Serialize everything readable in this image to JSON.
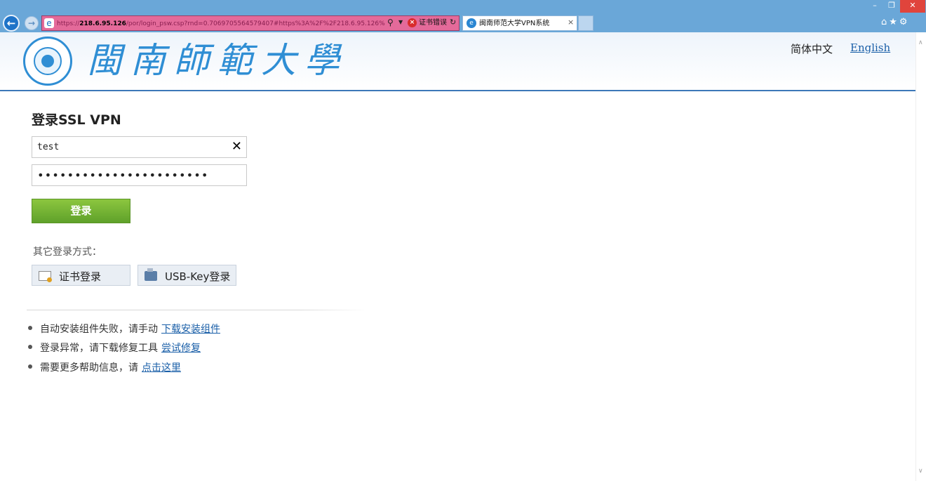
{
  "browser": {
    "url_prefix": "https://",
    "url_host": "218.6.95.126",
    "url_rest": "/por/login_psw.csp?rnd=0.7069705564579407#https%3A%2F%2F218.6.95.126%",
    "cert_error": "证书错误",
    "tab_title": "闽南师范大学VPN系统",
    "tab_close": "×",
    "win_min": "–",
    "win_max": "❐",
    "win_close": "✕",
    "toolbar_icons": "⌂★⚙"
  },
  "header": {
    "logo_text": "閩南師範大學",
    "lang_cn": "简体中文",
    "lang_en": "English"
  },
  "login": {
    "title": "登录SSL VPN",
    "username": "test",
    "password": "•••••••••••••••••••••••",
    "clear": "✕",
    "submit": "登录"
  },
  "alt_login": {
    "title": "其它登录方式：",
    "cert_button": "证书登录",
    "usb_button": "USB-Key登录"
  },
  "help": [
    {
      "text": "自动安装组件失败，请手动",
      "link": "下载安装组件"
    },
    {
      "text": "登录异常，请下载修复工具",
      "link": "尝试修复"
    },
    {
      "text": "需要更多帮助信息，请",
      "link": "点击这里"
    }
  ]
}
